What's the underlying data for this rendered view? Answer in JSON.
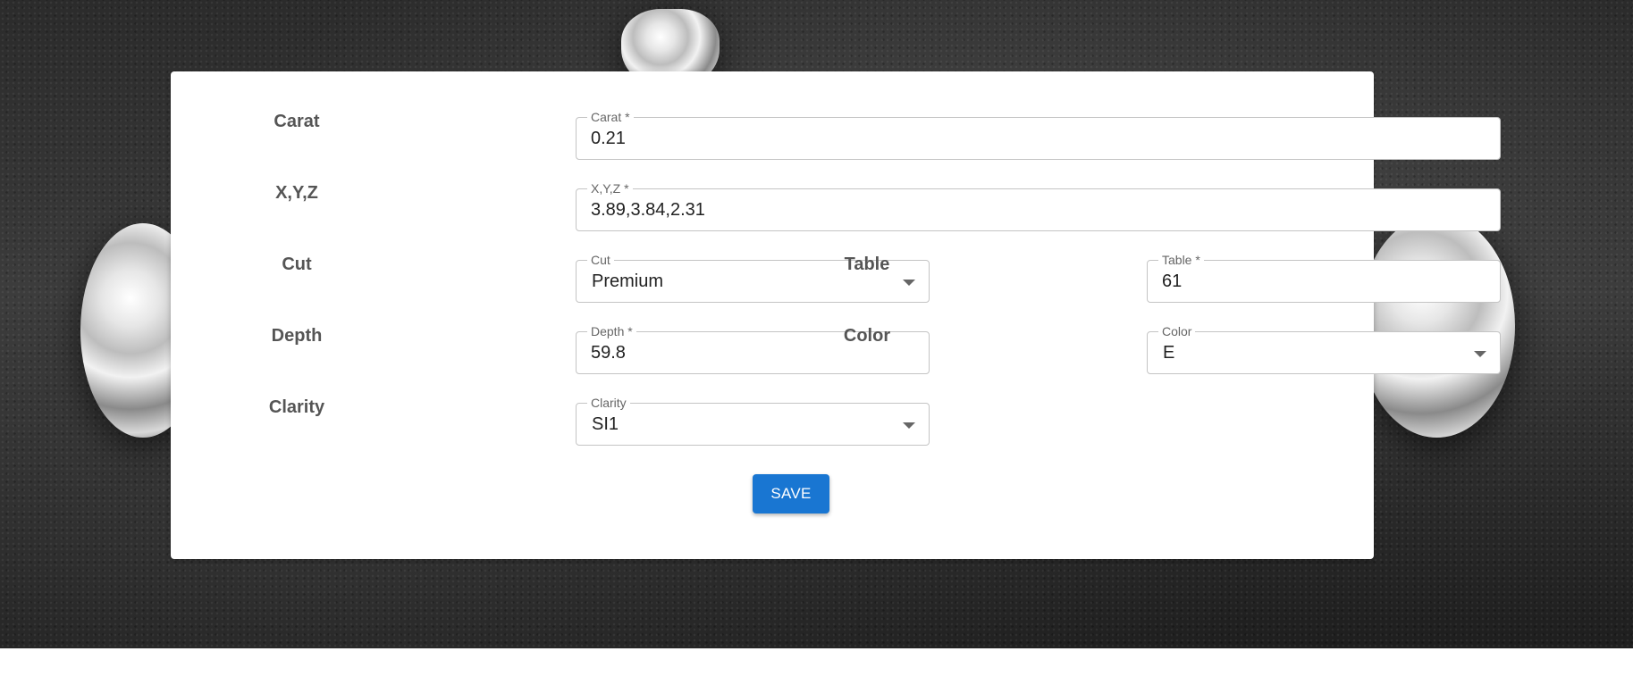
{
  "form": {
    "carat": {
      "label": "Carat",
      "legend": "Carat *",
      "value": "0.21"
    },
    "xyz": {
      "label": "X,Y,Z",
      "legend": "X,Y,Z *",
      "value": "3.89,3.84,2.31"
    },
    "cut": {
      "label": "Cut",
      "legend": "Cut",
      "value": "Premium"
    },
    "table": {
      "label": "Table",
      "legend": "Table *",
      "value": "61"
    },
    "depth": {
      "label": "Depth",
      "legend": "Depth *",
      "value": "59.8"
    },
    "color": {
      "label": "Color",
      "legend": "Color",
      "value": "E"
    },
    "clarity": {
      "label": "Clarity",
      "legend": "Clarity",
      "value": "SI1"
    },
    "save_label": "SAVE"
  },
  "theme": {
    "accent": "#1976d2",
    "label_color": "#555555",
    "border_color": "#c4c4c4"
  },
  "icons": {
    "dropdown": "caret-down-icon"
  }
}
